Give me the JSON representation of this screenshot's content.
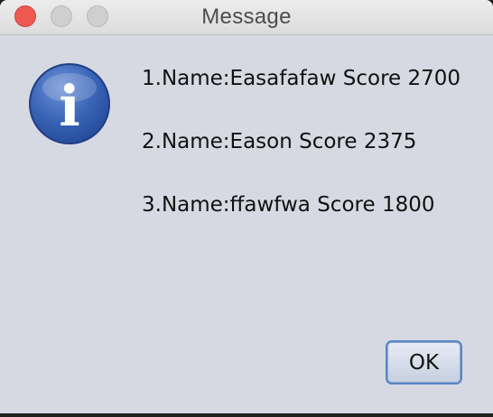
{
  "window": {
    "title": "Message"
  },
  "icon": {
    "name": "info-icon",
    "glyph": "i",
    "color": "#3a64b6"
  },
  "messages": [
    "1.Name:Easafafaw Score 2700",
    "2.Name:Eason Score 2375",
    "3.Name:ffawfwa Score 1800"
  ],
  "buttons": {
    "ok_label": "OK"
  },
  "colors": {
    "background": "#d6d9e2",
    "close": "#ee5a52",
    "accent": "#5a86c2"
  }
}
